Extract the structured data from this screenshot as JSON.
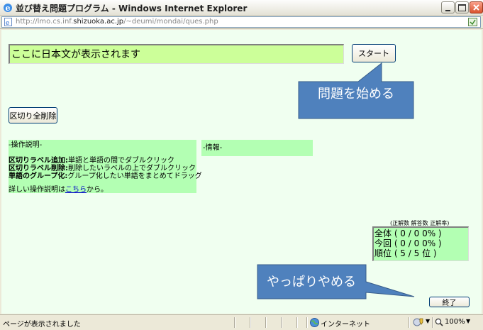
{
  "window": {
    "title": "並び替え問題プログラム - Windows Internet Explorer",
    "address_prefix": "http://lmo.cs.inf.",
    "address_host": "shizuoka.ac.jp",
    "address_path": "/~deumi/mondai/ques.php"
  },
  "main": {
    "sentence_placeholder": "ここに日本文が表示されます",
    "start_button": "スタート",
    "start_callout": "問題を始める",
    "clear_cuts_button": "区切り全削除",
    "end_button": "終了",
    "quit_callout": "やっぱりやめる"
  },
  "instructions": {
    "heading": "-操作説明-",
    "item1_key": "区切りラベル追加:",
    "item1_text": "単語と単語の間でダブルクリック",
    "item2_key": "区切りラベル削除:",
    "item2_text": "削除したいラベルの上でダブルクリック",
    "item3_key": "単語のグループ化:",
    "item3_text": "グループ化したい単語をまとめてドラッグ",
    "detail_prefix": "詳しい操作説明は",
    "detail_link": "こちら",
    "detail_suffix": "から。"
  },
  "info": {
    "heading": "-情報-"
  },
  "score": {
    "caption": "(正解数 解答数 正解率)",
    "rows": [
      "全体 ( 0 / 0 0% )",
      "今回 ( 0 / 0 0% )",
      "順位 ( 5 / 5 位 )"
    ]
  },
  "statusbar": {
    "status": "ページが表示されました",
    "zone": "インターネット",
    "zoom": "100%"
  },
  "colors": {
    "page_background": "#f0fff0",
    "sentence_box": "#ccff99",
    "panel_green": "#b3ffb3",
    "callout_blue": "#4f81bd"
  }
}
